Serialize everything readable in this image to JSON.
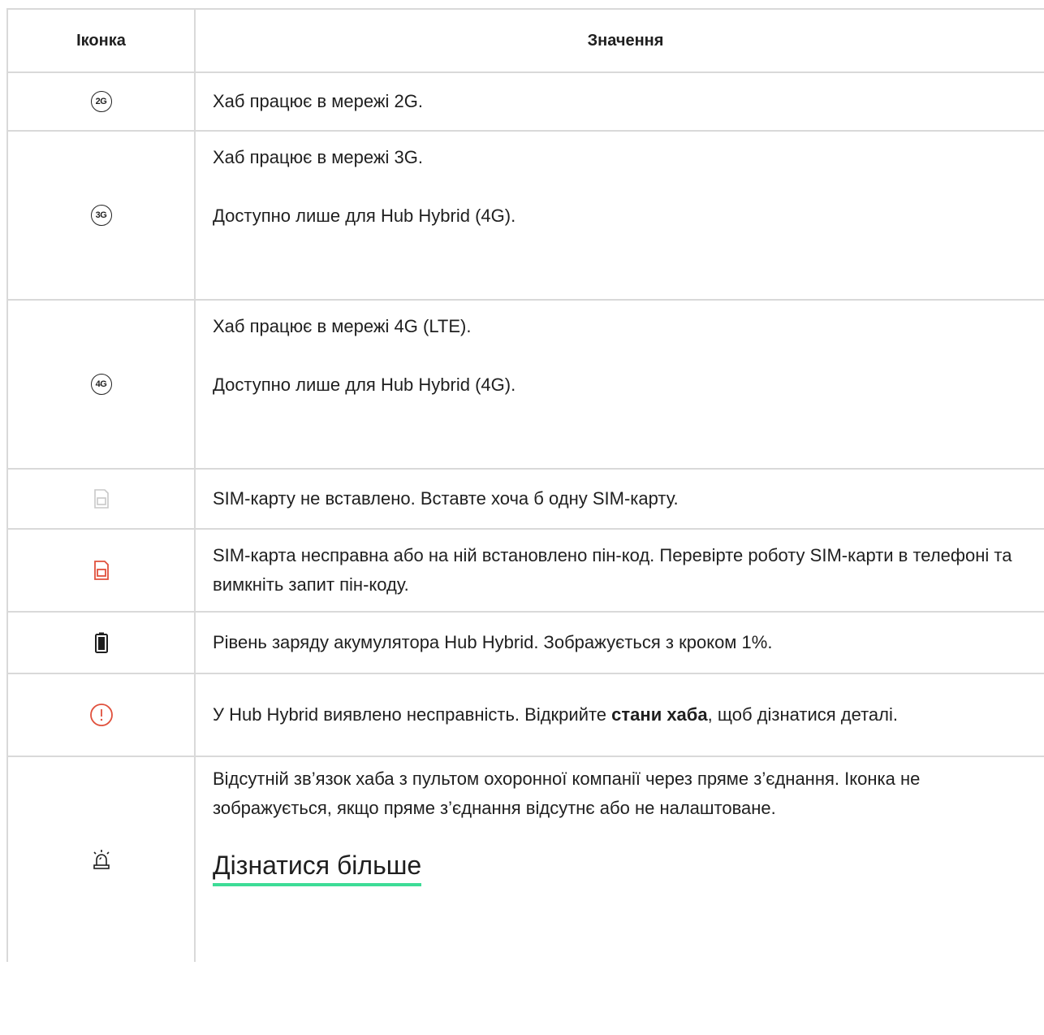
{
  "table": {
    "header": {
      "icon_col": "Іконка",
      "meaning_col": "Значення"
    },
    "rows": [
      {
        "icon": "2g-network-icon",
        "badge": "2G",
        "paragraphs": [
          "Хаб працює в мережі 2G."
        ]
      },
      {
        "icon": "3g-network-icon",
        "badge": "3G",
        "paragraphs": [
          "Хаб працює в мережі 3G.",
          "Доступно лише для Hub Hybrid (4G)."
        ]
      },
      {
        "icon": "4g-network-icon",
        "badge": "4G",
        "paragraphs": [
          "Хаб працює в мережі 4G (LTE).",
          "Доступно лише для Hub Hybrid (4G)."
        ]
      },
      {
        "icon": "sim-card-missing-icon",
        "paragraphs": [
          "SIM-карту не вставлено. Вставте хоча б одну SIM-карту."
        ]
      },
      {
        "icon": "sim-card-error-icon",
        "paragraphs": [
          "SIM-карта несправна або на ній встановлено пін-код. Перевірте роботу SIM-карти в телефоні та вимкніть запит пін-коду."
        ]
      },
      {
        "icon": "battery-icon",
        "paragraphs": [
          "Рівень заряду акумулятора Hub Hybrid. Зображується з кроком 1%."
        ]
      },
      {
        "icon": "fault-warning-icon",
        "text_before": "У Hub Hybrid виявлено несправність. Відкрийте ",
        "text_bold": "стани хаба",
        "text_after": ", щоб дізнатися деталі."
      },
      {
        "icon": "alarm-siren-icon",
        "paragraphs": [
          "Відсутній зв’язок хаба з пультом охоронної компанії через пряме з’єднання. Іконка не зображується, якщо пряме з’єднання відсутнє або не налаштоване."
        ],
        "link": "Дізнатися більше"
      }
    ]
  },
  "colors": {
    "border": "#d9d9d9",
    "text": "#1f1f1f",
    "sim_missing": "#c8c8c8",
    "error_red": "#e0503c",
    "link_underline": "#3ddc97"
  }
}
